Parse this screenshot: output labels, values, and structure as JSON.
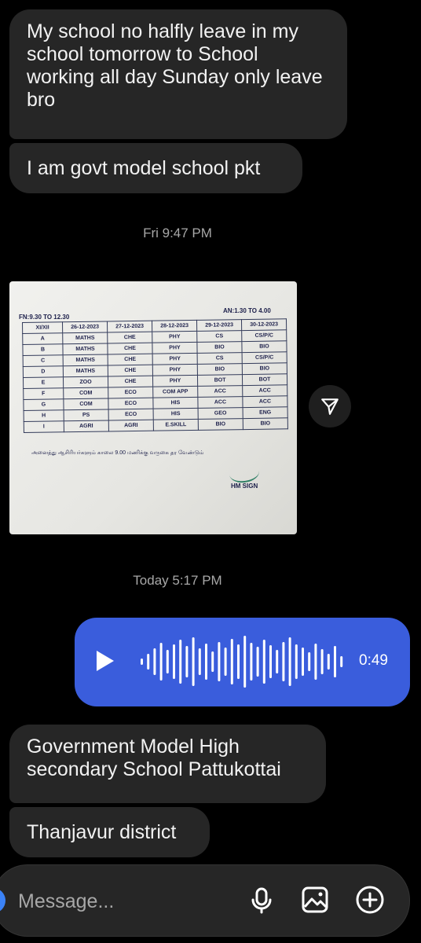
{
  "messages": [
    {
      "text": "My school no halfly leave in my school  tomorrow to  School working all day Sunday only leave bro"
    },
    {
      "text": "I am govt model school pkt"
    },
    {
      "text": "Government Model High secondary School Pattukottai"
    },
    {
      "text": "Thanjavur district"
    }
  ],
  "timestamps": {
    "first": "Fri 9:47 PM",
    "second": "Today 5:17 PM"
  },
  "photo": {
    "fn_label": "FN:9.30 TO 12.30",
    "an_label": "AN:1.30 TO 4.00",
    "table": [
      [
        "XI/XII",
        "26-12-2023",
        "27-12-2023",
        "28-12-2023",
        "29-12-2023",
        "30-12-2023"
      ],
      [
        "A",
        "MATHS",
        "CHE",
        "PHY",
        "CS",
        "CS/P/C"
      ],
      [
        "B",
        "MATHS",
        "CHE",
        "PHY",
        "BIO",
        "BIO"
      ],
      [
        "C",
        "MATHS",
        "CHE",
        "PHY",
        "CS",
        "CS/P/C"
      ],
      [
        "D",
        "MATHS",
        "CHE",
        "PHY",
        "BIO",
        "BIO"
      ],
      [
        "E",
        "ZOO",
        "CHE",
        "PHY",
        "BOT",
        "BOT"
      ],
      [
        "F",
        "COM",
        "ECO",
        "COM APP",
        "ACC",
        "ACC"
      ],
      [
        "G",
        "COM",
        "ECO",
        "HIS",
        "ACC",
        "ACC"
      ],
      [
        "H",
        "PS",
        "ECO",
        "HIS",
        "GEO",
        "ENG"
      ],
      [
        "I",
        "AGRI",
        "AGRI",
        "E.SKILL",
        "BIO",
        "BIO"
      ]
    ],
    "tamil_note": "அனைத்து ஆசிரியர்களும் காலை 9.00 மணிக்கு வருகை தர வேண்டும்",
    "hm_sign": "HM SIGN"
  },
  "voice": {
    "duration": "0:49",
    "accent": "#3a5ddc"
  },
  "composer": {
    "placeholder": "Message...",
    "icons": [
      "camera-icon",
      "microphone-icon",
      "gallery-icon",
      "add-icon"
    ]
  }
}
